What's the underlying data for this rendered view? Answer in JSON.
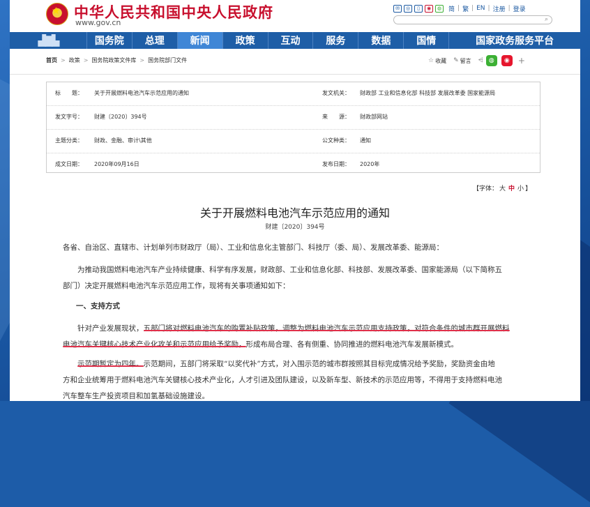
{
  "header": {
    "site_title": "中华人民共和国中央人民政府",
    "site_url": "www.gov.cn",
    "toolbar": {
      "links": [
        "简",
        "繁",
        "EN",
        "注册",
        "登录"
      ]
    },
    "search": {
      "placeholder": ""
    }
  },
  "nav": {
    "items": [
      "国务院",
      "总理",
      "新闻",
      "政策",
      "互动",
      "服务",
      "数据",
      "国情",
      "国家政务服务平台"
    ],
    "active": "新闻"
  },
  "breadcrumb": [
    "首页",
    "政策",
    "国务院政策文件库",
    "国务院部门文件"
  ],
  "share": {
    "collect": "收藏",
    "comment": "留言"
  },
  "info": {
    "rows": [
      {
        "l_label": "标　　题：",
        "l_value": "关于开展燃料电池汽车示范应用的通知",
        "r_label": "发文机关：",
        "r_value": "财政部  工业和信息化部  科技部  发展改革委  国家能源局"
      },
      {
        "l_label": "发文字号：",
        "l_value": "财建〔2020〕394号",
        "r_label": "来　　源：",
        "r_value": "财政部网站"
      },
      {
        "l_label": "主题分类：",
        "l_value": "财政、金融、审计\\其他",
        "r_label": "公文种类：",
        "r_value": "通知"
      },
      {
        "l_label": "成文日期：",
        "l_value": "2020年09月16日",
        "r_label": "发布日期：",
        "r_value": "2020年"
      }
    ]
  },
  "fontsize": {
    "prefix": "【字体：",
    "big": "大",
    "mid": "中",
    "small": "小",
    "suffix": "】"
  },
  "article": {
    "title": "关于开展燃料电池汽车示范应用的通知",
    "doc_num": "财建〔2020〕394号",
    "p1": "各省、自治区、直辖市、计划单列市财政厅（局）、工业和信息化主管部门、科技厅（委、局）、发展改革委、能源局：",
    "p2_l1": "为推动我国燃料电池汽车产业持续健康、科学有序发展，财政部、工业和信息化部、科技部、发展改革委、国家能源局（以下简称五",
    "p2_l2": "部门）决定开展燃料电池汽车示范应用工作，现将有关事项通知如下：",
    "sec1": "一、支持方式",
    "p3_l1_a": "针对产业发展现状，",
    "p3_l1_b": "五部门将对燃料电池汽车的购置补贴政策，调整为燃料电池汽车示范应用支持政策，对符合条件的城市群开展燃料",
    "p3_l2_a": "电池汽车关键核心技术产业化攻关和示范应用给予奖励，",
    "p3_l2_b": "形成布局合理、各有侧重、协同推进的燃料电池汽车发展新模式。",
    "p4_l1_a": "示范期暂定为四年。",
    "p4_l1_b": "示范期间，五部门将采取“以奖代补”方式，对入围示范的城市群按照其目标完成情况给予奖励，奖励资金由地",
    "p4_l2": "方和企业统筹用于燃料电池汽车关键核心技术产业化，人才引进及团队建设，以及新车型、新技术的示范应用等，不得用于支持燃料电池",
    "p4_l3": "汽车整车生产投资项目和加氢基础设施建设。"
  }
}
